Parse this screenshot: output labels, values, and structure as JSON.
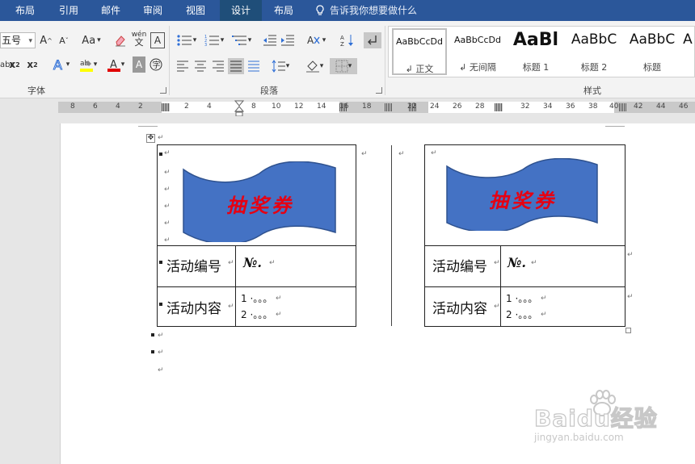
{
  "ribbon": {
    "tabs": [
      "布局",
      "引用",
      "邮件",
      "审阅",
      "视图",
      "设计",
      "布局"
    ],
    "active_tab_index": 5,
    "tell_me": "告诉我你想要做什么",
    "font_size": "五号",
    "change_case": "Aa",
    "phonetic": "wén",
    "groups": {
      "font": "字体",
      "paragraph": "段落",
      "styles": "样式"
    },
    "styles": [
      {
        "sample": "AaBbCcDd",
        "name": "↲ 正文"
      },
      {
        "sample": "AaBbCcDd",
        "name": "↲ 无间隔"
      },
      {
        "sample": "AaBl",
        "name": "标题 1"
      },
      {
        "sample": "AaBbC",
        "name": "标题 2"
      },
      {
        "sample": "AaBbC",
        "name": "标题"
      },
      {
        "sample": "A",
        "name": ""
      }
    ]
  },
  "ruler": {
    "numbers": [
      "8",
      "6",
      "4",
      "2",
      "2",
      "4",
      "8",
      "10",
      "12",
      "14",
      "16",
      "18",
      "22",
      "24",
      "26",
      "28",
      "32",
      "34",
      "36",
      "38",
      "40",
      "42",
      "44",
      "46"
    ]
  },
  "document": {
    "coupon_title": "抽奖券",
    "paragraph_mark": "↵",
    "tickets": [
      {
        "label_id": "活动编号",
        "id_value": "№.",
        "label_content": "活动内容",
        "line1": "1 ·。。。",
        "line2": "2 ·。。。"
      },
      {
        "label_id": "活动编号",
        "id_value": "№.",
        "label_content": "活动内容",
        "line1": "1 ·。。。",
        "line2": "2 ·。。。"
      }
    ]
  },
  "watermark": {
    "brand": "Baidu经验",
    "url": "jingyan.baidu.com"
  },
  "colors": {
    "ribbon_blue": "#2b579a",
    "banner_blue": "#4472c4",
    "banner_text": "#e60012"
  }
}
